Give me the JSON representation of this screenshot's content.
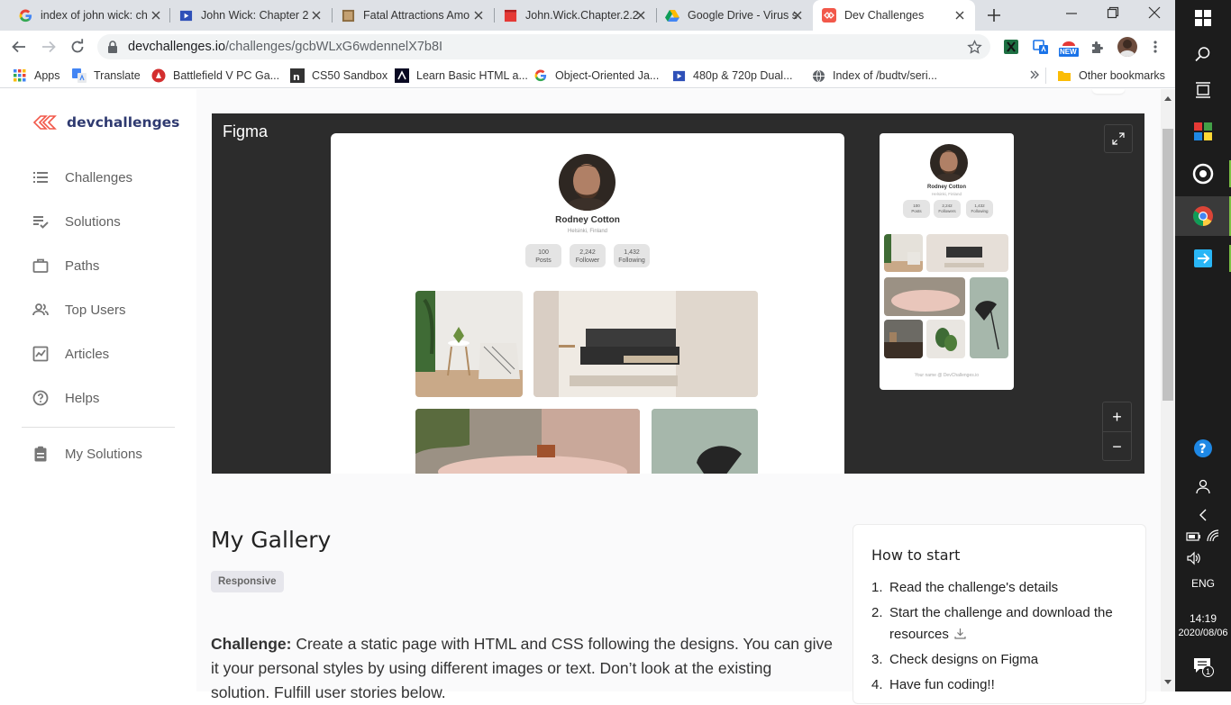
{
  "browser": {
    "tabs": [
      {
        "title": "index of john wick: ch",
        "icon": "google-icon"
      },
      {
        "title": "John Wick: Chapter 2",
        "icon": "video-site-icon"
      },
      {
        "title": "Fatal Attractions Amo",
        "icon": "book-cover-icon"
      },
      {
        "title": "John.Wick.Chapter.2.2",
        "icon": "movie-clapper-icon"
      },
      {
        "title": "Google Drive - Virus s",
        "icon": "google-drive-icon"
      },
      {
        "title": "Dev Challenges",
        "icon": "devchallenges-icon",
        "active": true
      }
    ],
    "url_host": "devchallenges.io",
    "url_path": "/challenges/gcbWLxG6wdennelX7b8I",
    "bookmarks": [
      {
        "label": "Apps",
        "icon": "apps-grid-icon"
      },
      {
        "label": "Translate",
        "icon": "translate-icon"
      },
      {
        "label": "Battlefield V PC Ga...",
        "icon": "battlefield-icon"
      },
      {
        "label": "CS50 Sandbox",
        "icon": "cs50-icon"
      },
      {
        "label": "Learn Basic HTML a...",
        "icon": "freecodecamp-icon"
      },
      {
        "label": "Object-Oriented Ja...",
        "icon": "google-icon"
      },
      {
        "label": "480p & 720p Dual...",
        "icon": "video-site-icon"
      },
      {
        "label": "Index of /budtv/seri...",
        "icon": "globe-icon"
      }
    ],
    "other_bookmarks": "Other bookmarks",
    "extension_badge": "NEW"
  },
  "sidebar": {
    "logo": "devchallenges",
    "items": [
      {
        "label": "Challenges",
        "icon": "list-icon"
      },
      {
        "label": "Solutions",
        "icon": "checklist-icon"
      },
      {
        "label": "Paths",
        "icon": "briefcase-icon"
      },
      {
        "label": "Top Users",
        "icon": "users-icon"
      },
      {
        "label": "Articles",
        "icon": "article-chart-icon"
      },
      {
        "label": "Helps",
        "icon": "help-circle-icon"
      }
    ],
    "my_solutions": "My Solutions"
  },
  "figma": {
    "label": "Figma",
    "zoom_in": "+",
    "zoom_out": "−",
    "desktop": {
      "name": "Rodney Cotton",
      "location": "Helsinki, Finland",
      "stats": [
        {
          "value": "100",
          "label": "Posts"
        },
        {
          "value": "2,242",
          "label": "Follower"
        },
        {
          "value": "1,432",
          "label": "Following"
        }
      ]
    },
    "mobile": {
      "name": "Rodney Cotton",
      "location": "Helsinki, Finland",
      "stats": [
        {
          "value": "100",
          "label": "Posts"
        },
        {
          "value": "2,242",
          "label": "Followers"
        },
        {
          "value": "1,432",
          "label": "Following"
        }
      ],
      "footer": "Your name @ DevChallenges.io"
    }
  },
  "challenge": {
    "title": "My Gallery",
    "tag": "Responsive",
    "desc_label": "Challenge:",
    "desc_text": " Create a static page with HTML and CSS following the designs. You can give it your personal styles by using different images or text. Don’t look at the existing solution. Fulfill user stories below."
  },
  "how_to_start": {
    "title": "How to start",
    "steps": [
      {
        "num": "1.",
        "text": "Read the challenge's details"
      },
      {
        "num": "2.",
        "text": "Start the challenge and download the resources"
      },
      {
        "num": "3.",
        "text": "Check designs on Figma"
      },
      {
        "num": "4.",
        "text": "Have fun coding!!"
      }
    ]
  },
  "taskbar": {
    "language": "ENG",
    "time": "14:19",
    "date": "2020/08/06",
    "notification_count": "1"
  }
}
